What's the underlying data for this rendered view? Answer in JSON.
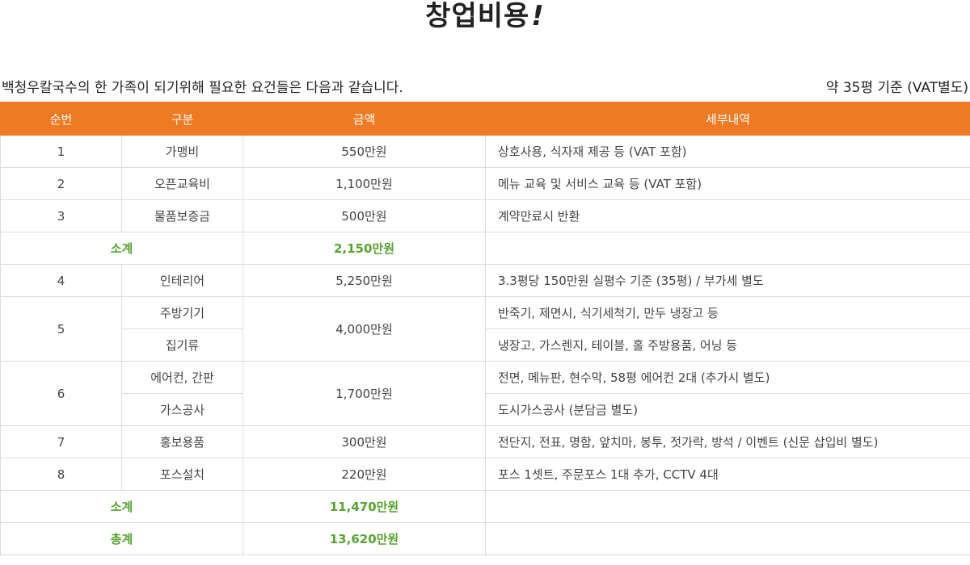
{
  "page": {
    "title": "창업비용",
    "title_mark": "!",
    "subtitle_left": "백청우칼국수의 한 가족이 되기위해 필요한 요건들은 다음과 같습니다.",
    "subtitle_right": "약 35평 기준 (VAT별도)"
  },
  "colors": {
    "header_bg": "#ee7a24",
    "subtotal_text": "#58a331",
    "border": "#dcdcdc"
  },
  "table": {
    "headers": [
      "순번",
      "구분",
      "금액",
      "세부내역"
    ],
    "rows": [
      {
        "no": "1",
        "category": "가맹비",
        "amount": "550만원",
        "detail": "상호사용, 식자재 제공 등 (VAT 포함)"
      },
      {
        "no": "2",
        "category": "오픈교육비",
        "amount": "1,100만원",
        "detail": "메뉴 교육 및 서비스 교육 등 (VAT 포함)"
      },
      {
        "no": "3",
        "category": "물품보증금",
        "amount": "500만원",
        "detail": "계약만료시 반환"
      },
      {
        "subtotal_label": "소계",
        "subtotal_amount": "2,150만원"
      },
      {
        "no": "4",
        "category": "인테리어",
        "amount": "5,250만원",
        "detail": "3.3평당 150만원 실평수 기준 (35평) / 부가세 별도"
      },
      {
        "no": "5",
        "category": "주방기기",
        "amount": "4,000만원",
        "detail": "반죽기, 제면시, 식기세척기, 만두 냉장고 등"
      },
      {
        "category": "집기류",
        "detail": "냉장고, 가스렌지, 테이블, 홀 주방용품, 어닝 등"
      },
      {
        "no": "6",
        "category": "에어컨, 간판",
        "amount": "1,700만원",
        "detail": "전면, 메뉴판, 현수막, 58평 에어컨 2대 (추가시 별도)"
      },
      {
        "category": "가스공사",
        "detail": "도시가스공사 (분담금 별도)"
      },
      {
        "no": "7",
        "category": "홍보용품",
        "amount": "300만원",
        "detail": "전단지, 전표, 명함, 앞치마, 봉투, 젓가락, 방석 / 이벤트 (신문 삽입비 별도)"
      },
      {
        "no": "8",
        "category": "포스설치",
        "amount": "220만원",
        "detail": "포스 1셋트, 주문포스 1대 추가, CCTV 4대"
      },
      {
        "subtotal_label": "소계",
        "subtotal_amount": "11,470만원"
      },
      {
        "subtotal_label": "총계",
        "subtotal_amount": "13,620만원"
      }
    ]
  }
}
